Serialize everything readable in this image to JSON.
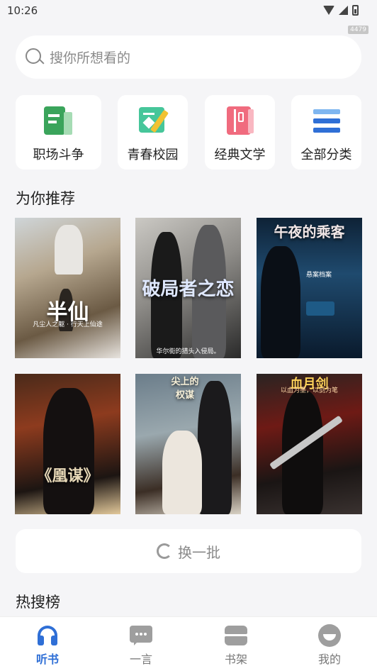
{
  "status_bar": {
    "time": "10:26",
    "badge": "4479"
  },
  "search": {
    "placeholder": "搜你所想看的"
  },
  "categories": [
    {
      "label": "职场斗争",
      "icon": "document-chart-icon",
      "color": "#3aa45b"
    },
    {
      "label": "青春校园",
      "icon": "notebook-heart-icon",
      "color": "#46c69a"
    },
    {
      "label": "经典文学",
      "icon": "notebook-icon",
      "color": "#f06b7e"
    },
    {
      "label": "全部分类",
      "icon": "category-list-icon",
      "color": "#2f6fd6"
    }
  ],
  "recommend": {
    "title": "为你推荐",
    "books": [
      {
        "cover_title": "半仙",
        "cover_caption": "凡尘人之躯 · 行天上仙途"
      },
      {
        "cover_title": "破局者之恋",
        "cover_caption": "华尔街的猎头入侵局。"
      },
      {
        "cover_title": "午夜的乘客",
        "cover_caption": "悬案档案"
      },
      {
        "cover_title": "《凰谋》",
        "cover_caption": ""
      },
      {
        "cover_title": "尖上的权谋",
        "cover_caption": ""
      },
      {
        "cover_title": "血月剑",
        "cover_caption": "以血为墨，以剑为笔"
      }
    ]
  },
  "refresh": {
    "label": "换一批"
  },
  "hot_search": {
    "title": "热搜榜"
  },
  "tabs": [
    {
      "label": "听书",
      "icon": "headphones-icon",
      "active": true
    },
    {
      "label": "一言",
      "icon": "chat-bubble-icon",
      "active": false
    },
    {
      "label": "书架",
      "icon": "bookshelf-icon",
      "active": false
    },
    {
      "label": "我的",
      "icon": "profile-icon",
      "active": false
    }
  ],
  "colors": {
    "accent": "#2f6fd6",
    "background": "#f5f5f7"
  }
}
